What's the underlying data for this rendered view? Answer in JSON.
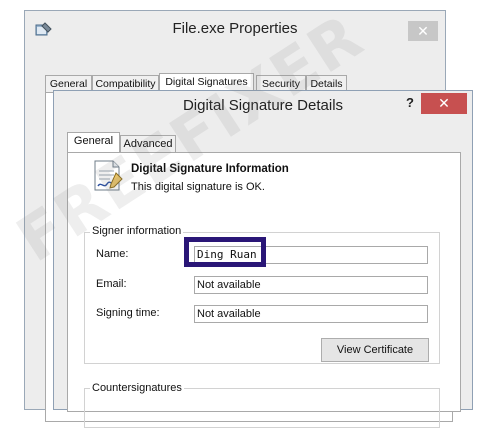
{
  "outer_window": {
    "title": "File.exe Properties",
    "close_label": "✕",
    "tabs": [
      {
        "label": "General"
      },
      {
        "label": "Compatibility"
      },
      {
        "label": "Digital Signatures"
      },
      {
        "label": "Security"
      },
      {
        "label": "Details"
      }
    ],
    "active_tab": "Digital Signatures"
  },
  "dialog": {
    "title": "Digital Signature Details",
    "help_label": "?",
    "close_label": "✕",
    "tabs": [
      {
        "label": "General"
      },
      {
        "label": "Advanced"
      }
    ],
    "active_tab": "General",
    "info_heading": "Digital Signature Information",
    "info_status": "This digital signature is OK.",
    "signer_group_label": "Signer information",
    "fields": {
      "name_label": "Name:",
      "name_value": "Ding Ruan",
      "email_label": "Email:",
      "email_value": "Not available",
      "time_label": "Signing time:",
      "time_value": "Not available"
    },
    "view_certificate_label": "View Certificate",
    "countersignatures_label": "Countersignatures"
  },
  "watermark": "FREEFIXER",
  "colors": {
    "highlight_border": "#2a1677",
    "close_button": "#c75050"
  }
}
